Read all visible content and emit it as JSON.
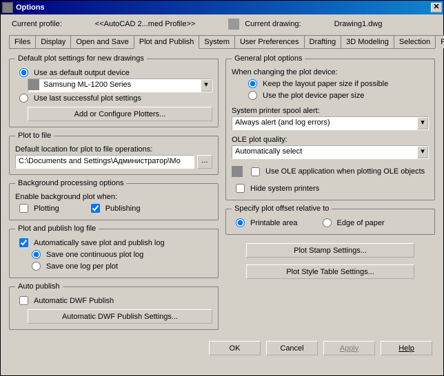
{
  "window": {
    "title": "Options"
  },
  "header": {
    "profile_label": "Current profile:",
    "profile_value": "<<AutoCAD 2...med Profile>>",
    "drawing_label": "Current drawing:",
    "drawing_value": "Drawing1.dwg"
  },
  "tabs": [
    "Files",
    "Display",
    "Open and Save",
    "Plot and Publish",
    "System",
    "User Preferences",
    "Drafting",
    "3D Modeling",
    "Selection",
    "Profiles"
  ],
  "left": {
    "default_plot": {
      "legend": "Default plot settings for new drawings",
      "use_default": "Use as default output device",
      "printer": "Samsung ML-1200 Series",
      "use_last": "Use last successful plot settings",
      "add_plotters": "Add or Configure Plotters..."
    },
    "plot_to_file": {
      "legend": "Plot to file",
      "loc_label": "Default location for plot to file operations:",
      "path": "C:\\Documents and Settings\\Администратор\\Мо"
    },
    "bg": {
      "legend": "Background processing options",
      "enable_label": "Enable background plot when:",
      "plotting": "Plotting",
      "publishing": "Publishing"
    },
    "log": {
      "legend": "Plot and publish log file",
      "auto_save": "Automatically save plot and publish log",
      "one_continuous": "Save one continuous plot log",
      "one_per": "Save one log per plot"
    },
    "auto_pub": {
      "legend": "Auto publish",
      "auto_dwf": "Automatic DWF Publish",
      "settings_btn": "Automatic DWF Publish Settings..."
    }
  },
  "right": {
    "general": {
      "legend": "General plot options",
      "changing_label": "When changing the plot device:",
      "keep_layout": "Keep the layout paper size if possible",
      "use_device": "Use the plot device paper size",
      "spool_label": "System printer spool alert:",
      "spool_value": "Always alert (and log errors)",
      "ole_label": "OLE plot quality:",
      "ole_value": "Automatically select",
      "use_ole": "Use OLE application when plotting OLE objects",
      "hide_printers": "Hide system printers"
    },
    "offset": {
      "legend": "Specify plot offset relative to",
      "printable": "Printable area",
      "edge": "Edge of paper"
    },
    "stamp_btn": "Plot Stamp Settings...",
    "style_btn": "Plot Style Table Settings..."
  },
  "footer": {
    "ok": "OK",
    "cancel": "Cancel",
    "apply": "Apply",
    "help": "Help"
  }
}
